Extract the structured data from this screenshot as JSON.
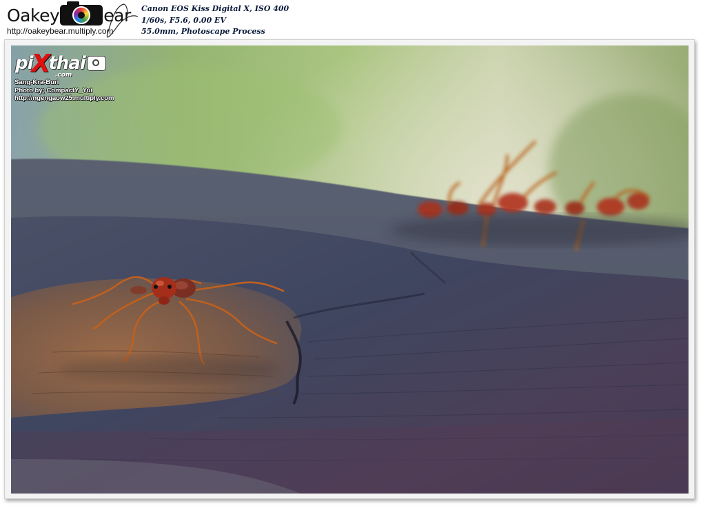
{
  "header": {
    "logo": {
      "text_left": "Oakey",
      "text_right": "ear",
      "icon": "camera-icon"
    },
    "url": "http://oakeybear.multiply.com",
    "exif_lines": [
      "Canon EOS Kiss Digital X, ISO 400",
      "1/60s, F5.6, 0.00 EV",
      "55.0mm, Photoscape Process"
    ]
  },
  "watermark": {
    "logo_left": "pi",
    "logo_x": "X",
    "logo_right": "thai",
    "logo_suffix": ".com",
    "icon": "camera-icon",
    "lines": [
      "Sang-Kra-Buri",
      "Photo by; CompactY_Yui",
      "http://ngengaow25.multiply.com"
    ]
  },
  "photo": {
    "subject": "weaver ants on a log",
    "colors": {
      "background_green": "#8fb06a",
      "wood_blue": "#3f4660",
      "wood_brown": "#7a5a48",
      "ant_red": "#b0301c"
    }
  }
}
